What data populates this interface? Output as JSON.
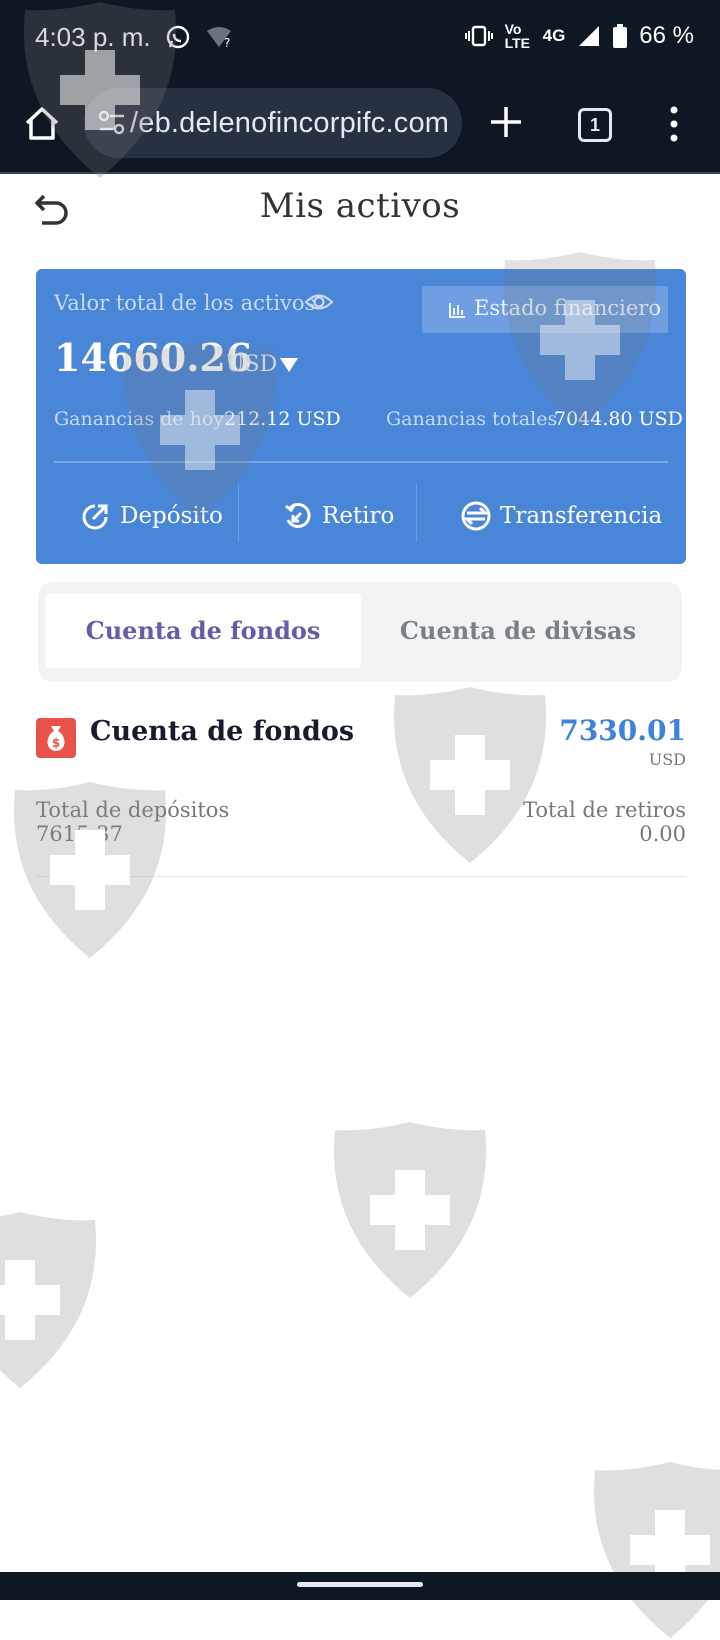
{
  "status_bar": {
    "time": "4:03 p. m.",
    "network_volte": "Vo LTE",
    "network_type": "4G",
    "battery": "66 %",
    "icons": [
      "whatsapp-icon",
      "wifi-question-icon",
      "vibrate-icon",
      "volte-icon",
      "signal-icon",
      "battery-icon"
    ]
  },
  "browser": {
    "url": "/eb.delenofincorpifc.com",
    "tab_count": "1",
    "icons": [
      "home-icon",
      "site-settings-icon",
      "plus-icon",
      "tabs-icon",
      "more-vert-icon"
    ]
  },
  "header": {
    "title": "Mis activos",
    "back_icon": "undo-arrow-icon"
  },
  "assets": {
    "label": "Valor total de los activos",
    "statement_button": "Estado financiero",
    "total": "14660.26",
    "currency": "USD",
    "today_label": "Ganancias de hoy",
    "today_value": "212.12 USD",
    "alltime_label": "Ganancias totales",
    "alltime_value": "7044.80 USD",
    "actions": {
      "deposit": "Depósito",
      "withdraw": "Retiro",
      "transfer": "Transferencia"
    },
    "card_color": "#4a86d8"
  },
  "tabs": {
    "active": "Cuenta de fondos",
    "inactive": "Cuenta de divisas"
  },
  "fund_account": {
    "title": "Cuenta de fondos",
    "value": "7330.01",
    "currency": "USD",
    "deposits_label": "Total de depósitos",
    "deposits_value": "7615.37",
    "withdrawals_label": "Total de retiros",
    "withdrawals_value": "0.00",
    "value_color": "#3f82d9"
  }
}
